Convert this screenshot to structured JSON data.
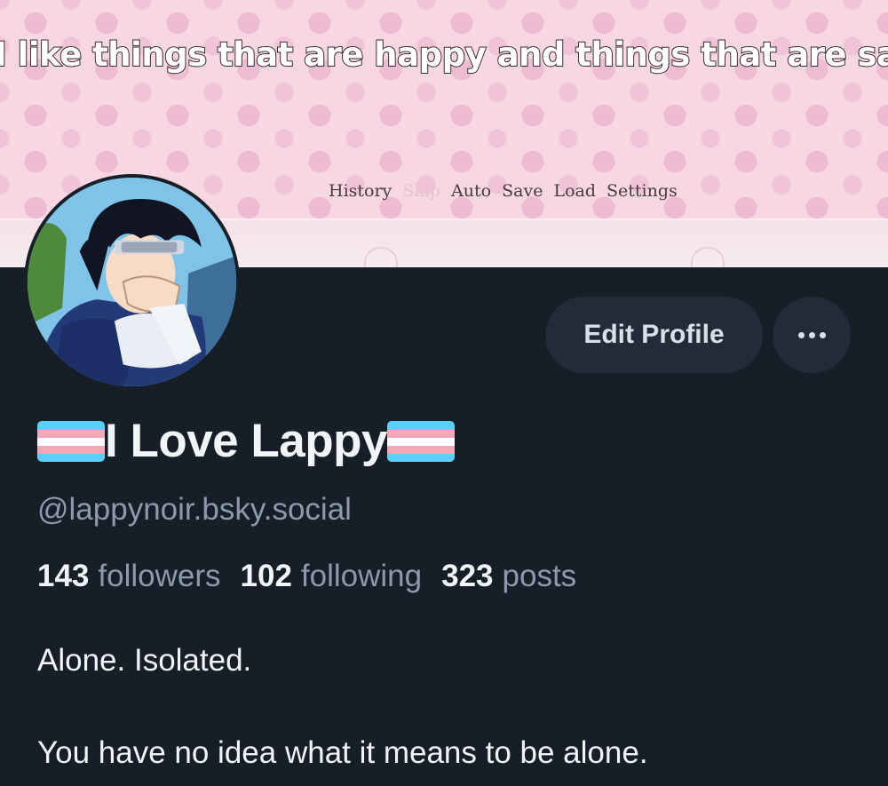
{
  "banner": {
    "caption": "I like things that are happy and things that are sad.",
    "menu": [
      "History",
      "Skip",
      "Auto",
      "Save",
      "Load",
      "Settings"
    ]
  },
  "profile": {
    "display_name": "I Love Lappy",
    "flag_icon": "transgender-flag-icon",
    "handle": "@lappynoir.bsky.social",
    "stats": {
      "followers_count": "143",
      "followers_label": "followers",
      "following_count": "102",
      "following_label": "following",
      "posts_count": "323",
      "posts_label": "posts"
    },
    "bio": [
      "Alone. Isolated.",
      "You have no idea what it means to be alone."
    ]
  },
  "actions": {
    "edit_profile_label": "Edit Profile",
    "more_icon": "ellipsis-icon"
  },
  "colors": {
    "background": "#161e27",
    "button_bg": "#212c38",
    "muted_text": "#8c9aab",
    "flag_blue": "#5bcefa",
    "flag_pink": "#f5a9b8",
    "flag_white": "#ffffff"
  }
}
